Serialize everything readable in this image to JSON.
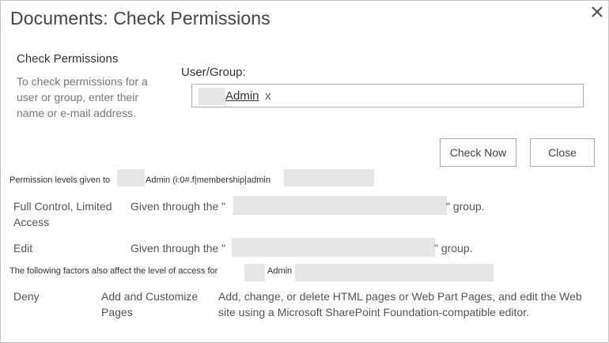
{
  "dialog": {
    "title": "Documents: Check Permissions",
    "close_icon": "close-icon"
  },
  "section": {
    "title": "Check Permissions",
    "description": "To check permissions for a user or group, enter their name or e-mail address."
  },
  "field": {
    "label": "User/Group:",
    "user_name": "Admin",
    "remove_label": "x"
  },
  "buttons": {
    "check_now": "Check Now",
    "close": "Close"
  },
  "results": {
    "header_prefix": "Permission levels given to",
    "header_user": "Admin (i:0#.f|membership|admin",
    "rows": [
      {
        "level": "Full Control, Limited Access",
        "desc_prefix": "Given through the \"",
        "desc_suffix": "\" group."
      },
      {
        "level": "Edit",
        "desc_prefix": "Given through the \"",
        "desc_suffix": "\" group."
      }
    ]
  },
  "factors": {
    "header_prefix": "The following factors also affect the level of access for",
    "header_user": "Admin",
    "type": "Deny",
    "permission": "Add and Customize Pages",
    "description": "Add, change, or delete HTML pages or Web Part Pages, and edit the Web site using a Microsoft SharePoint Foundation-compatible editor."
  },
  "colors": {
    "text": "#444444",
    "border": "#ababab",
    "redaction": "#e6e6e6"
  }
}
